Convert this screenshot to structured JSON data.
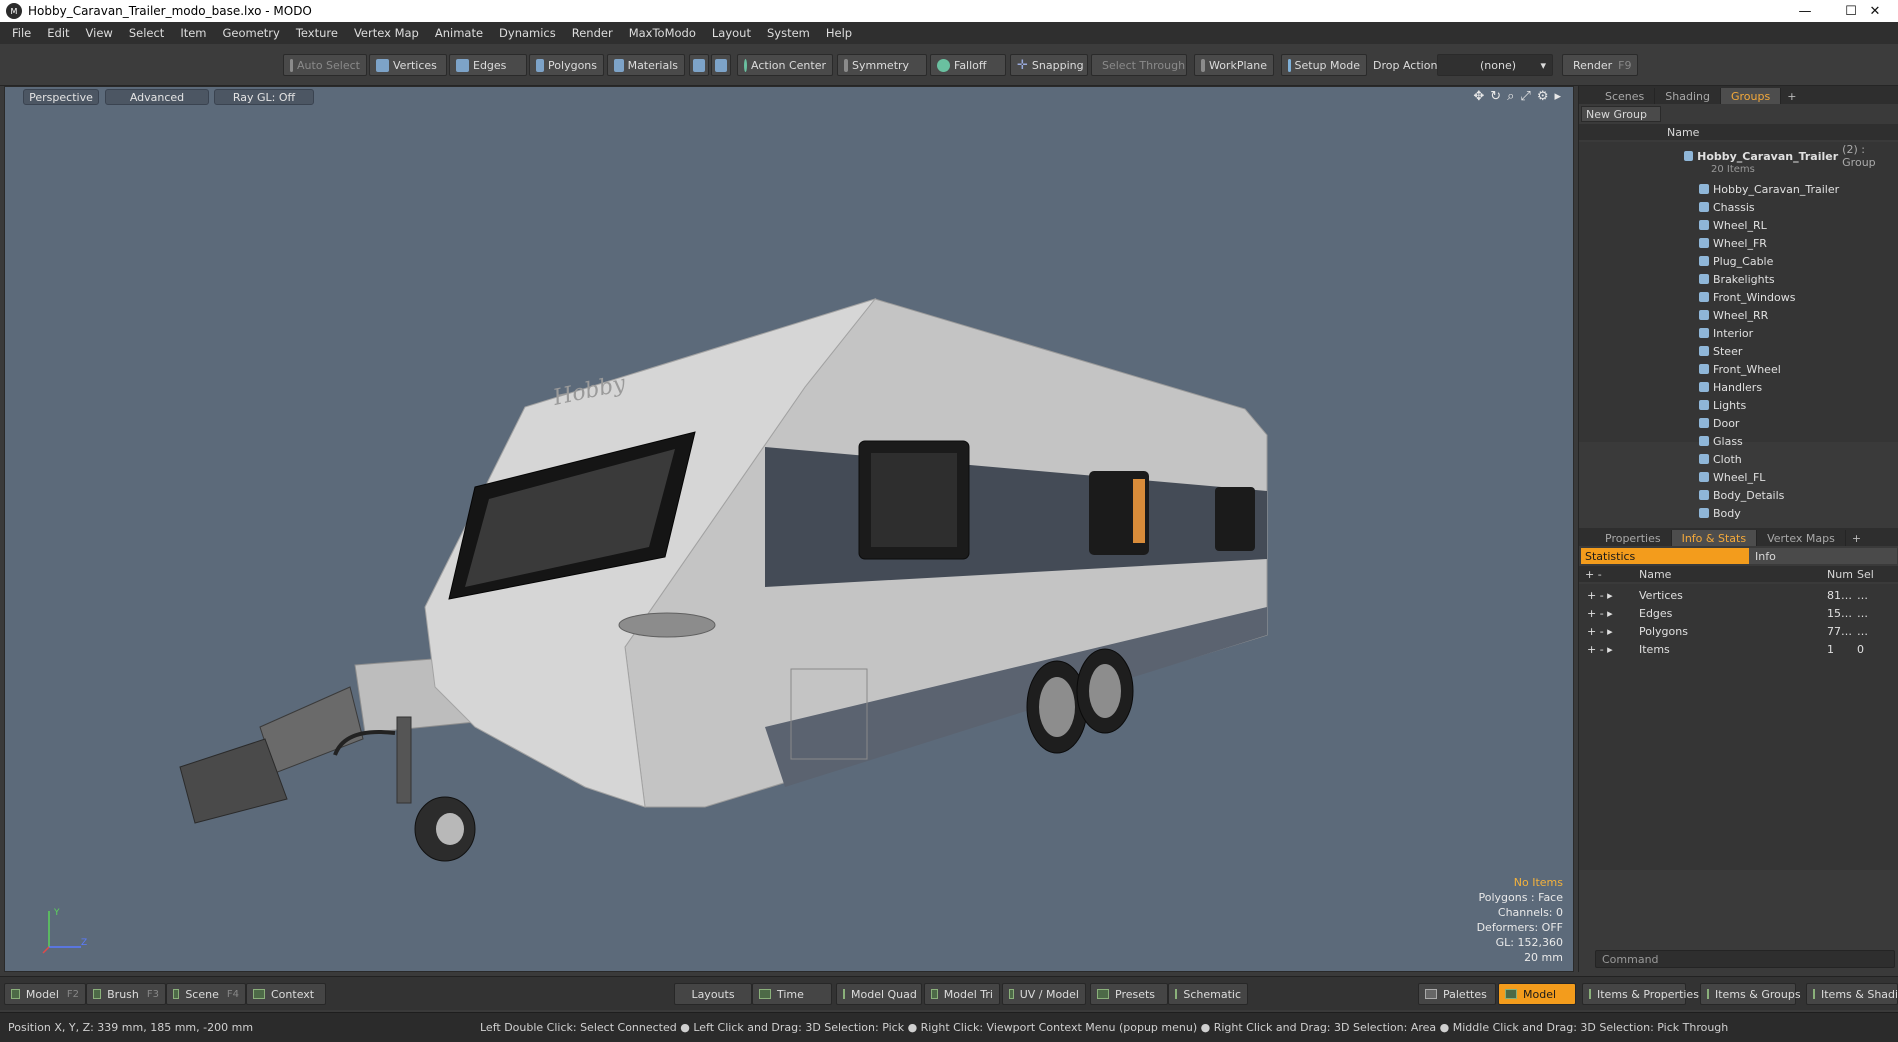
{
  "window": {
    "title": "Hobby_Caravan_Trailer_modo_base.lxo - MODO",
    "app_icon": "modo-logo-icon",
    "minimize": "—",
    "maximize": "☐",
    "close": "✕"
  },
  "menu": [
    "File",
    "Edit",
    "View",
    "Select",
    "Item",
    "Geometry",
    "Texture",
    "Vertex Map",
    "Animate",
    "Dynamics",
    "Render",
    "MaxToModo",
    "Layout",
    "System",
    "Help"
  ],
  "toolbar": {
    "auto_select": "Auto Select",
    "vertices": "Vertices",
    "edges": "Edges",
    "polygons": "Polygons",
    "materials": "Materials",
    "action_center": "Action Center",
    "symmetry": "Symmetry",
    "falloff": "Falloff",
    "snapping": "Snapping",
    "select_through": "Select Through",
    "workplane": "WorkPlane",
    "setup_mode": "Setup Mode",
    "drop_action_label": "Drop Action",
    "drop_action_value": "(none)",
    "render": "Render",
    "render_key": "F9"
  },
  "viewport": {
    "view_mode": "Perspective",
    "shading": "Advanced",
    "raygl": "Ray GL: Off",
    "logo_text": "Hobby",
    "hud": {
      "selection": "No Items",
      "polygons": "Polygons : Face",
      "channels": "Channels: 0",
      "deformers": "Deformers: OFF",
      "gl": "GL: 152,360",
      "scale": "20 mm"
    },
    "axis_labels": {
      "y": "Y",
      "z": "Z"
    }
  },
  "groups_panel": {
    "tabs": [
      "Scenes",
      "Shading",
      "Groups"
    ],
    "active_tab": "Groups",
    "new_group": "New Group",
    "column_name": "Name",
    "group_name": "Hobby_Caravan_Trailer",
    "group_suffix": "(2) : Group",
    "group_count": "20 Items",
    "items": [
      "Hobby_Caravan_Trailer",
      "Chassis",
      "Wheel_RL",
      "Wheel_FR",
      "Plug_Cable",
      "Brakelights",
      "Front_Windows",
      "Wheel_RR",
      "Interior",
      "Steer",
      "Front_Wheel",
      "Handlers",
      "Lights",
      "Door",
      "Glass",
      "Cloth",
      "Wheel_FL",
      "Body_Details",
      "Body"
    ]
  },
  "stats_panel": {
    "tabs": [
      "Properties",
      "Info & Stats",
      "Vertex Maps"
    ],
    "active_tab": "Info & Stats",
    "subtabs": [
      "Statistics",
      "Info"
    ],
    "columns": {
      "name": "Name",
      "num": "Num",
      "sel": "Sel"
    },
    "rows": [
      {
        "name": "Vertices",
        "num": "81…",
        "sel": "…"
      },
      {
        "name": "Edges",
        "num": "15…",
        "sel": "…"
      },
      {
        "name": "Polygons",
        "num": "77…",
        "sel": "…"
      },
      {
        "name": "Items",
        "num": "1",
        "sel": "0"
      }
    ],
    "command_placeholder": "Command"
  },
  "bottom_bar": {
    "model": "Model",
    "model_key": "F2",
    "brush": "Brush",
    "brush_key": "F3",
    "scene": "Scene",
    "scene_key": "F4",
    "context": "Context",
    "layouts": "Layouts",
    "time": "Time",
    "model_quad": "Model Quad",
    "model_tri": "Model Tri",
    "uv_model": "UV / Model",
    "presets": "Presets",
    "schematic": "Schematic",
    "palettes": "Palettes",
    "model_active": "Model",
    "items_properties": "Items & Properties",
    "items_groups": "Items & Groups",
    "items_shading": "Items & Shadi"
  },
  "status": {
    "position": "Position X, Y, Z:   339 mm, 185 mm, -200 mm",
    "hints": "Left Double Click: Select Connected ● Left Click and Drag: 3D Selection: Pick ● Right Click: Viewport Context Menu (popup menu) ● Right Click and Drag: 3D Selection: Area ● Middle Click and Drag: 3D Selection: Pick Through"
  },
  "colors": {
    "accent": "#f39c1c",
    "viewport_bg": "#5c6a7a",
    "panel_bg": "#3a3a3a"
  }
}
